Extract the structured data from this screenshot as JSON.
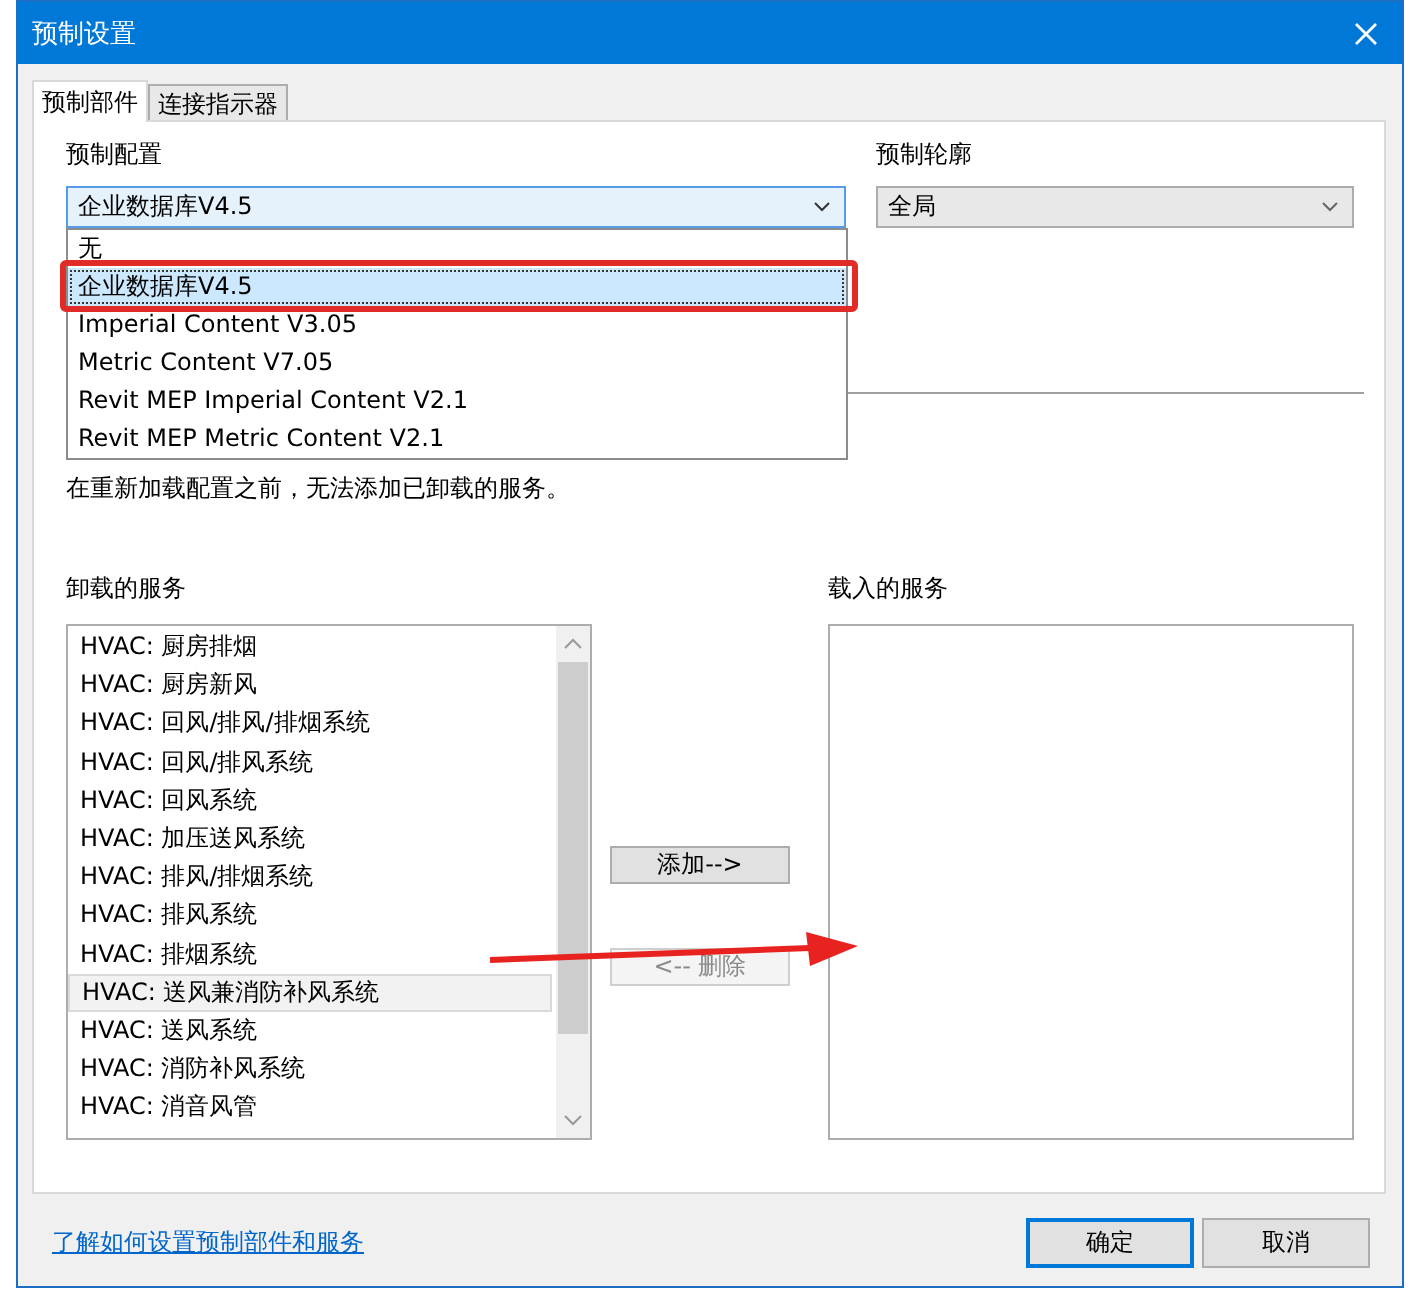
{
  "window": {
    "title": "预制设置"
  },
  "tabs": [
    {
      "label": "预制部件",
      "selected": true
    },
    {
      "label": "连接指示器",
      "selected": false
    }
  ],
  "config": {
    "label": "预制配置",
    "value": "企业数据库V4.5",
    "options": [
      {
        "label": "无",
        "selected": false
      },
      {
        "label": "企业数据库V4.5",
        "selected": true
      },
      {
        "label": "Imperial Content V3.05",
        "selected": false
      },
      {
        "label": "Metric Content V7.05",
        "selected": false
      },
      {
        "label": "Revit MEP Imperial Content V2.1",
        "selected": false
      },
      {
        "label": "Revit MEP Metric Content V2.1",
        "selected": false
      }
    ]
  },
  "profile": {
    "label": "预制轮廓",
    "value": "全局"
  },
  "notice": "在重新加载配置之前，无法添加已卸载的服务。",
  "unloaded": {
    "label": "卸载的服务",
    "items": [
      {
        "label": "HVAC: 厨房排烟",
        "selected": false
      },
      {
        "label": "HVAC: 厨房新风",
        "selected": false
      },
      {
        "label": "HVAC: 回风/排风/排烟系统",
        "selected": false
      },
      {
        "label": "HVAC: 回风/排风系统",
        "selected": false
      },
      {
        "label": "HVAC: 回风系统",
        "selected": false
      },
      {
        "label": "HVAC: 加压送风系统",
        "selected": false
      },
      {
        "label": "HVAC: 排风/排烟系统",
        "selected": false
      },
      {
        "label": "HVAC: 排风系统",
        "selected": false
      },
      {
        "label": "HVAC: 排烟系统",
        "selected": false
      },
      {
        "label": "HVAC: 送风兼消防补风系统",
        "selected": true
      },
      {
        "label": "HVAC: 送风系统",
        "selected": false
      },
      {
        "label": "HVAC: 消防补风系统",
        "selected": false
      },
      {
        "label": "HVAC: 消音风管",
        "selected": false
      }
    ]
  },
  "loaded": {
    "label": "载入的服务"
  },
  "move_buttons": [
    {
      "label": "添加-->",
      "disabled": false
    },
    {
      "label": "<-- 删除",
      "disabled": true
    }
  ],
  "help_link": "了解如何设置预制部件和服务",
  "footer_buttons": [
    {
      "label": "确定",
      "kind": "default"
    },
    {
      "label": "取消",
      "kind": "normal"
    }
  ]
}
